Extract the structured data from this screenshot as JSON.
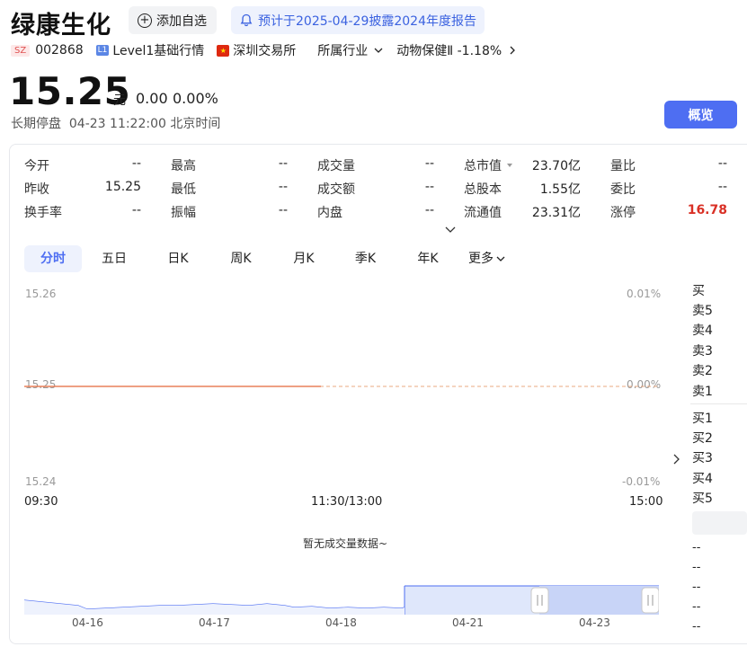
{
  "header": {
    "name": "绿康生化",
    "add_watch": "添加自选",
    "report_notice": "预计于2025-04-29披露2024年度报告"
  },
  "meta": {
    "exchange_tag": "SZ",
    "code": "002868",
    "level_tag": "L1",
    "level_text": "Level1基础行情",
    "market": "深圳交易所",
    "industry_label": "所属行业",
    "industry_value": "动物保健Ⅱ -1.18%"
  },
  "quote": {
    "price": "15.25",
    "unit": "元",
    "change": "0.00",
    "change_pct": "0.00%",
    "status": "长期停盘  04-23 11:22:00 北京时间"
  },
  "overview_button": "概览",
  "stats": [
    [
      {
        "label": "今开",
        "value": "--"
      },
      {
        "label": "最高",
        "value": "--"
      },
      {
        "label": "成交量",
        "value": "--"
      },
      {
        "label": "总市值",
        "value": "23.70亿"
      },
      {
        "label": "量比",
        "value": "--"
      }
    ],
    [
      {
        "label": "昨收",
        "value": "15.25"
      },
      {
        "label": "最低",
        "value": "--"
      },
      {
        "label": "成交额",
        "value": "--"
      },
      {
        "label": "总股本",
        "value": "1.55亿"
      },
      {
        "label": "委比",
        "value": "--"
      }
    ],
    [
      {
        "label": "换手率",
        "value": "--"
      },
      {
        "label": "振幅",
        "value": "--"
      },
      {
        "label": "内盘",
        "value": "--"
      },
      {
        "label": "流通值",
        "value": "23.31亿"
      },
      {
        "label": "涨停",
        "value": "16.78"
      }
    ]
  ],
  "tabs": [
    "分时",
    "五日",
    "日K",
    "周K",
    "月K",
    "季K",
    "年K",
    "更多"
  ],
  "active_tab": "分时",
  "chart_data": {
    "type": "line",
    "x_ticks": [
      "09:30",
      "11:30/13:00",
      "15:00"
    ],
    "y_ticks_left": [
      "15.26",
      "15.25",
      "15.24"
    ],
    "y_ticks_right": [
      "0.01%",
      "0.00%",
      "-0.01%"
    ],
    "series": [
      {
        "x": [
          "09:30",
          "11:30"
        ],
        "values": [
          15.25,
          15.25
        ]
      }
    ],
    "reference_value": 15.25,
    "ylim": [
      15.24,
      15.26
    ]
  },
  "volume_text": "暂无成交量数据~",
  "orderbook": {
    "top_label": "买",
    "sell": [
      "卖5",
      "卖4",
      "卖3",
      "卖2",
      "卖1"
    ],
    "buy": [
      "买1",
      "买2",
      "买3",
      "买4",
      "买5"
    ],
    "trades": [
      "--",
      "--",
      "--",
      "--",
      "--"
    ]
  },
  "mini_chart": {
    "dates": [
      "04-16",
      "04-17",
      "04-18",
      "04-21",
      "04-23"
    ]
  },
  "colors": {
    "accent": "#4e6ef2",
    "limit_up": "#d93025",
    "price_line": "#e8805a"
  }
}
